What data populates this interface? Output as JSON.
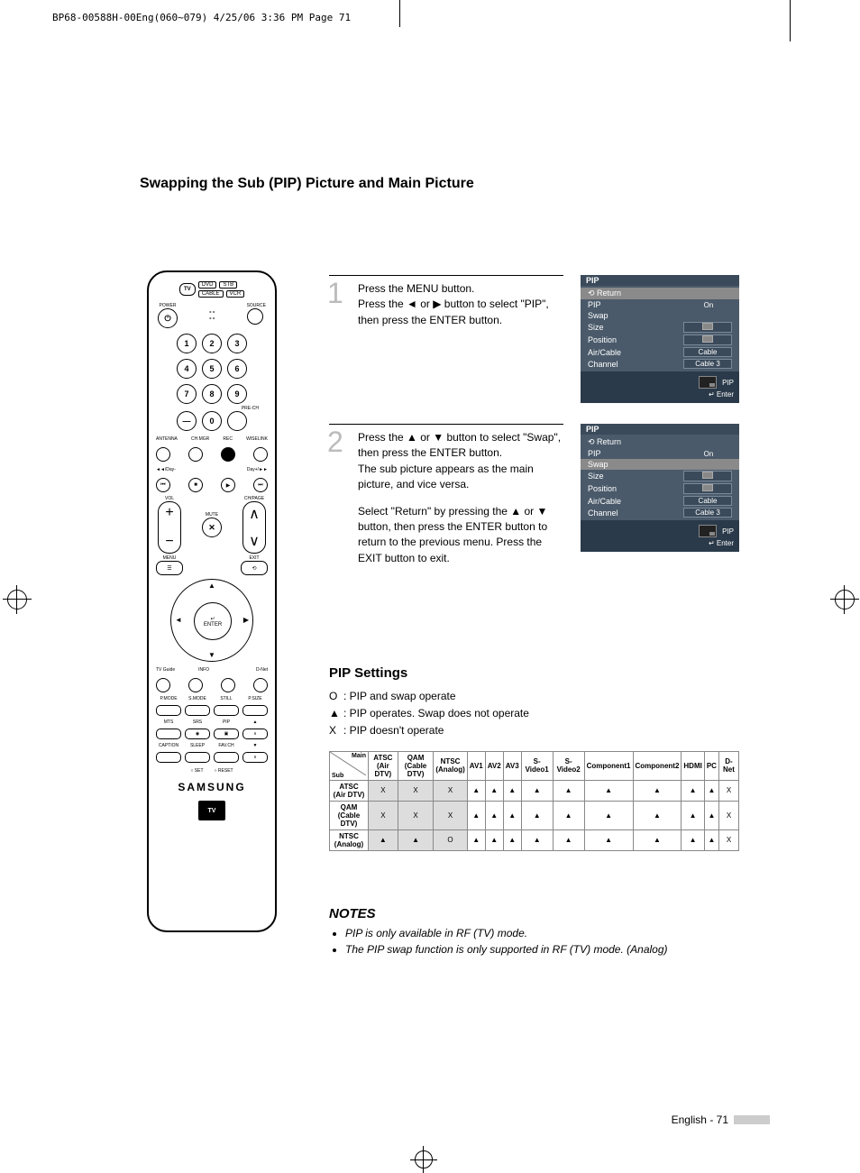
{
  "header_line": "BP68-00588H-00Eng(060~079)  4/25/06  3:36 PM  Page 71",
  "page_title": "Swapping the Sub (PIP) Picture and Main Picture",
  "remote": {
    "top_row": [
      "TV",
      "DVD",
      "STB",
      "CABLE",
      "VCR"
    ],
    "power": "POWER",
    "source": "SOURCE",
    "numbers": [
      "1",
      "2",
      "3",
      "4",
      "5",
      "6",
      "7",
      "8",
      "9",
      "0"
    ],
    "dash": "—",
    "prech": "PRE-CH",
    "row_labels1": [
      "ANTENNA",
      "CH.MGR",
      "REC",
      "WISELINK"
    ],
    "row_labels2": [
      "◄◄/Day-",
      "",
      "",
      "Day+/►►"
    ],
    "vol": "VOL",
    "chpage": "CH/PAGE",
    "mute": "MUTE",
    "menu": "MENU",
    "exit": "EXIT",
    "enter": "ENTER",
    "bottom_row1": [
      "TV Guide",
      "INFO",
      "",
      "D-Net"
    ],
    "bottom_row2": [
      "P.MODE",
      "S.MODE",
      "STILL",
      "P.SIZE"
    ],
    "bottom_row3": [
      "MTS",
      "SRS",
      "PIP",
      "▲"
    ],
    "bottom_row4": [
      "CAPTION",
      "SLEEP",
      "FAV.CH",
      "▼"
    ],
    "set_reset": [
      "○ SET",
      "○ RESET"
    ],
    "brand": "SAMSUNG",
    "tvguide": "TV"
  },
  "step1": {
    "num": "1",
    "lines": [
      "Press the MENU button.",
      "Press the ◄ or ▶ button to select \"PIP\", then press the ENTER button."
    ]
  },
  "step2": {
    "num": "2",
    "lines": [
      "Press the ▲ or ▼ button to select \"Swap\", then press the ENTER button.",
      "The sub picture appears as the main picture, and vice versa.",
      "",
      "Select \"Return\" by pressing the ▲ or ▼ button, then press the ENTER button to return to the previous menu. Press the EXIT button to exit."
    ]
  },
  "osd": {
    "title": "PIP",
    "return": "Return",
    "rows": [
      {
        "label": "PIP",
        "value": "On",
        "boxed": false
      },
      {
        "label": "Swap",
        "value": "",
        "boxed": false
      },
      {
        "label": "Size",
        "value": "",
        "boxed": true,
        "icon": true
      },
      {
        "label": "Position",
        "value": "",
        "boxed": true,
        "icon": true
      },
      {
        "label": "Air/Cable",
        "value": "Cable",
        "boxed": true
      },
      {
        "label": "Channel",
        "value": "Cable 3",
        "boxed": true
      }
    ],
    "foot_pip": "PIP",
    "foot_enter": "Enter"
  },
  "pip_settings": {
    "title": "PIP Settings",
    "legend": [
      {
        "sym": "O",
        "text": ": PIP and swap operate"
      },
      {
        "sym": "▲",
        "text": ": PIP operates. Swap does not operate"
      },
      {
        "sym": "X",
        "text": ": PIP doesn't operate"
      }
    ]
  },
  "chart_data": {
    "type": "table",
    "title": "PIP Settings compatibility",
    "diag_main": "Main",
    "diag_sub": "Sub",
    "columns": [
      "ATSC (Air DTV)",
      "QAM (Cable DTV)",
      "NTSC (Analog)",
      "AV1",
      "AV2",
      "AV3",
      "S-Video1",
      "S-Video2",
      "Component1",
      "Component2",
      "HDMI",
      "PC",
      "D-Net"
    ],
    "rows": [
      {
        "label": "ATSC (Air DTV)",
        "cells": [
          "X",
          "X",
          "X",
          "▲",
          "▲",
          "▲",
          "▲",
          "▲",
          "▲",
          "▲",
          "▲",
          "▲",
          "X"
        ]
      },
      {
        "label": "QAM (Cable DTV)",
        "cells": [
          "X",
          "X",
          "X",
          "▲",
          "▲",
          "▲",
          "▲",
          "▲",
          "▲",
          "▲",
          "▲",
          "▲",
          "X"
        ]
      },
      {
        "label": "NTSC (Analog)",
        "cells": [
          "▲",
          "▲",
          "O",
          "▲",
          "▲",
          "▲",
          "▲",
          "▲",
          "▲",
          "▲",
          "▲",
          "▲",
          "X"
        ]
      }
    ]
  },
  "notes": {
    "title": "NOTES",
    "items": [
      "PIP is only available in RF (TV) mode.",
      "The PIP swap function is only supported in RF (TV) mode. (Analog)"
    ]
  },
  "footer": {
    "text": "English - 71"
  }
}
